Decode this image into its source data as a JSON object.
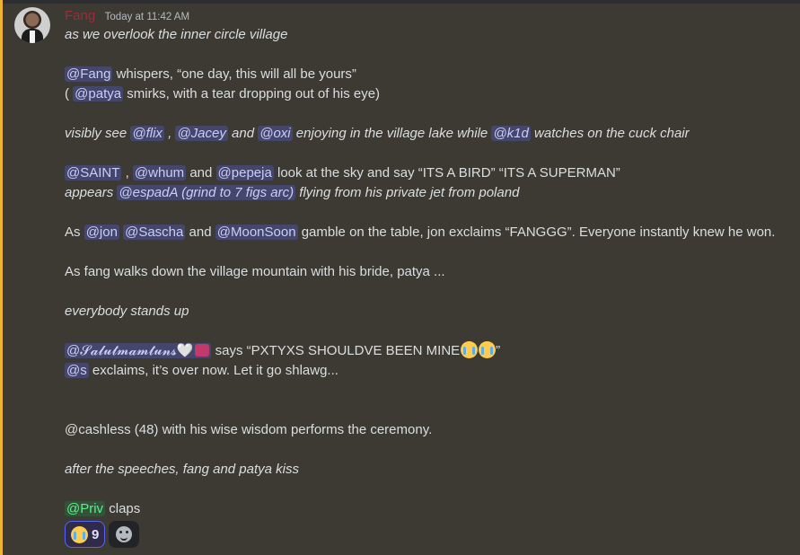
{
  "message": {
    "author": "Fang",
    "timestamp": "Today at 11:42 AM",
    "lines": {
      "l1": "as we overlook the inner circle village",
      "l2": {
        "m1": "@Fang",
        "t1": " whispers, “one day, this will all be yours”"
      },
      "l3": {
        "t0": "( ",
        "m1": "@patya",
        "t1": " smirks, with a  tear dropping out of his eye)"
      },
      "l4": {
        "t0": "visibly see ",
        "m1": "@flix",
        "t1": " , ",
        "m2": "@Jacey",
        "t2": "  and ",
        "m3": "@oxi",
        "t3": "   enjoying in the village lake while ",
        "m4": "@k1d",
        "t4": "  watches on the cuck chair"
      },
      "l5": {
        "m1": "@SAINT",
        "t1": " , ",
        "m2": "@whum",
        "t2": "  and ",
        "m3": "@pepeja",
        "t3": "   look at the sky and say “ITS A BIRD” “ITS A SUPERMAN”"
      },
      "l6": {
        "t0": "appears ",
        "m1": "@espadA (grind to 7 figs arc)",
        "t1": " flying from his private jet from poland"
      },
      "l7": {
        "t0": "As ",
        "m1": "@jon",
        "t1": "  ",
        "m2": "@Sascha",
        "t2": "  and ",
        "m3": "@MoonSoon",
        "t3": "   gamble on the table, jon exclaims “FANGGG”. Everyone instantly knew he won."
      },
      "l8": "As fang walks down the village mountain with his bride, patya ...",
      "l9": "everybody stands up",
      "l10": {
        "m1": "@𝓢𝓪𝓵𝓾𝓽𝓶𝓪𝓶𝓽𝓾𝓷𝓼",
        "heart": "🤍",
        "t1": " says “PXTYXS SHOULDVE BEEN MINE",
        "t2": "”"
      },
      "l11": {
        "m1": "@s",
        "t1": "  exclaims, it’s over now. Let it go shlawg..."
      },
      "l12": "@cashless (48) with his wise wisdom performs the ceremony.",
      "l13": "after the speeches, fang and patya kiss",
      "l14": {
        "m1": "@Priv",
        "t1": " claps"
      }
    },
    "reactions": [
      {
        "emoji": "sob-emoji",
        "count": "9"
      }
    ]
  },
  "colors": {
    "background": "#3d3a33",
    "author": "#9b2c3a",
    "mention_bg": "#5865f2",
    "highlight_bar": "#f0b232"
  }
}
